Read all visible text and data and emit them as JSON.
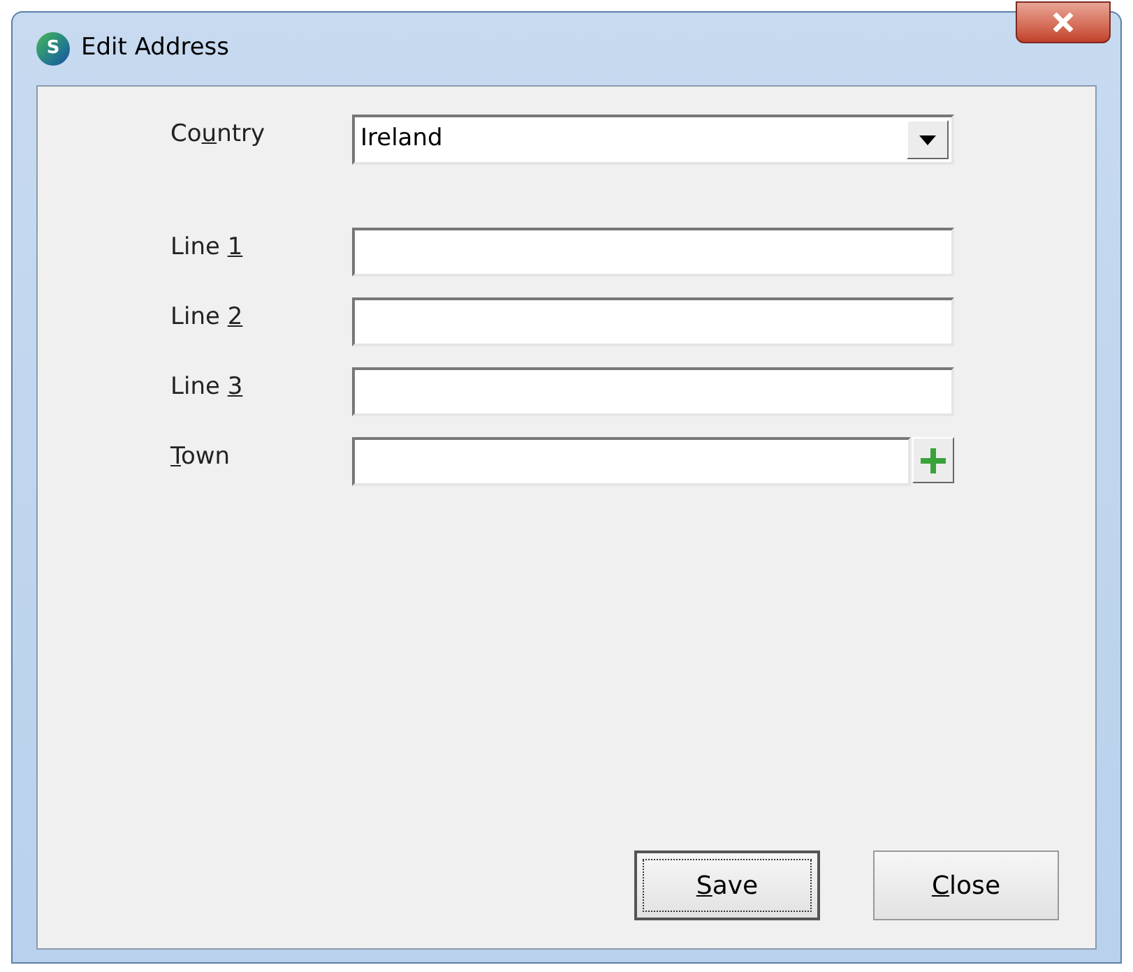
{
  "window": {
    "title": "Edit Address",
    "icon_letter": "S"
  },
  "fields": [
    {
      "kind": "dropdown",
      "label": {
        "pre": "Co",
        "key": "u",
        "post": "ntry"
      },
      "value": "Ireland"
    },
    {
      "kind": "text",
      "label": {
        "pre": "Line ",
        "key": "1"
      }
    },
    {
      "kind": "text",
      "label": {
        "pre": "Line ",
        "key": "2"
      }
    },
    {
      "kind": "text",
      "label": {
        "pre": "Line ",
        "key": "3"
      }
    },
    {
      "kind": "text_add",
      "label": {
        "key": "T",
        "post": "own"
      }
    }
  ],
  "buttons": [
    {
      "label": {
        "key": "S",
        "post": "ave"
      },
      "focused": true
    },
    {
      "label": {
        "key": "C",
        "post": "lose"
      },
      "focused": false
    }
  ]
}
